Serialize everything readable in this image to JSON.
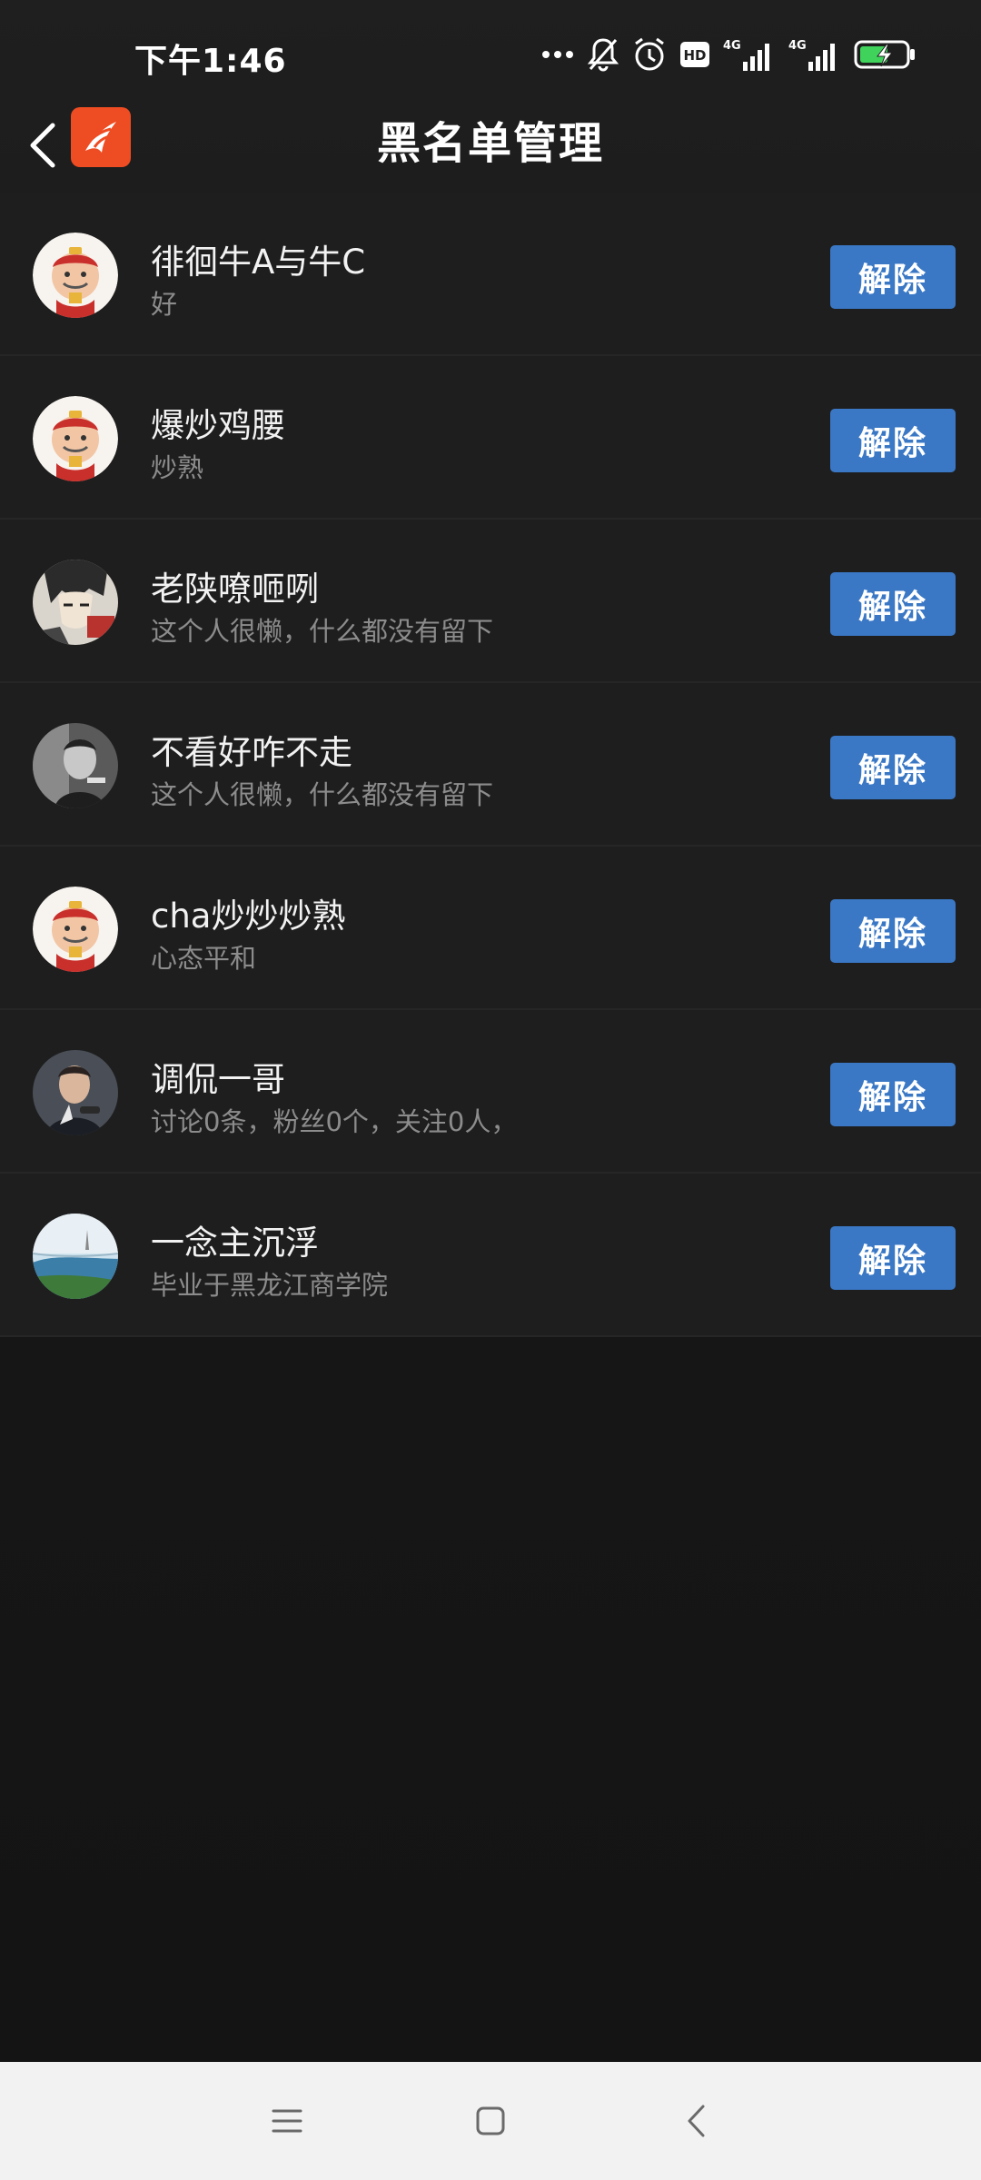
{
  "status_bar": {
    "time": "下午1:46",
    "network_1": "4G",
    "network_2": "4G",
    "hd_label": "HD"
  },
  "header": {
    "title": "黑名单管理",
    "back_icon": "chevron-left-icon",
    "logo_icon": "app-logo-icon"
  },
  "blacklist": {
    "action_label": "解除",
    "action_color": "#3a78c5",
    "items": [
      {
        "name": "徘徊牛A与牛C",
        "desc": "好",
        "avatar": "cartoon-god-of-wealth"
      },
      {
        "name": "爆炒鸡腰",
        "desc": "炒熟",
        "avatar": "cartoon-god-of-wealth"
      },
      {
        "name": "老陕嘹咂咧",
        "desc": "这个人很懒，什么都没有留下",
        "avatar": "manga-portrait"
      },
      {
        "name": "不看好咋不走",
        "desc": "这个人很懒，什么都没有留下",
        "avatar": "grayscale-photo"
      },
      {
        "name": "cha炒炒炒熟",
        "desc": "心态平和",
        "avatar": "cartoon-god-of-wealth"
      },
      {
        "name": "调侃一哥",
        "desc": "讨论0条，粉丝0个，关注0人，",
        "avatar": "man-portrait-photo"
      },
      {
        "name": "一念主沉浮",
        "desc": "毕业于黑龙江商学院",
        "avatar": "landscape-photo"
      }
    ]
  },
  "nav_bar": {
    "menu_icon": "menu-icon",
    "home_icon": "home-square-icon",
    "back_icon": "back-chevron-icon"
  }
}
